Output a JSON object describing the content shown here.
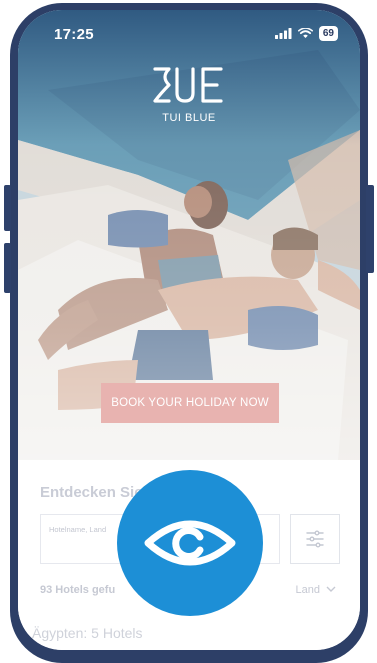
{
  "status_bar": {
    "time": "17:25",
    "battery": "69"
  },
  "brand": {
    "logo_text": "BLUE",
    "name": "TUI BLUE"
  },
  "hero": {
    "cta_label": "BOOK YOUR HOLIDAY NOW"
  },
  "search_section": {
    "title": "Entdecken Sie  Hotels",
    "placeholder": "Hotelname, Land",
    "results_count": "93 Hotels gefu",
    "sort_label": "Land",
    "country_header": "Ägypten: 5 Hotels"
  },
  "icons": {
    "signal": "cellular-signal-icon",
    "wifi": "wifi-icon",
    "filter": "sliders-icon",
    "chevron": "chevron-down-icon",
    "eye": "eye-icon"
  },
  "colors": {
    "frame": "#2d3f67",
    "cta": "#e8b3b0",
    "eye_badge": "#1d8fd6"
  }
}
